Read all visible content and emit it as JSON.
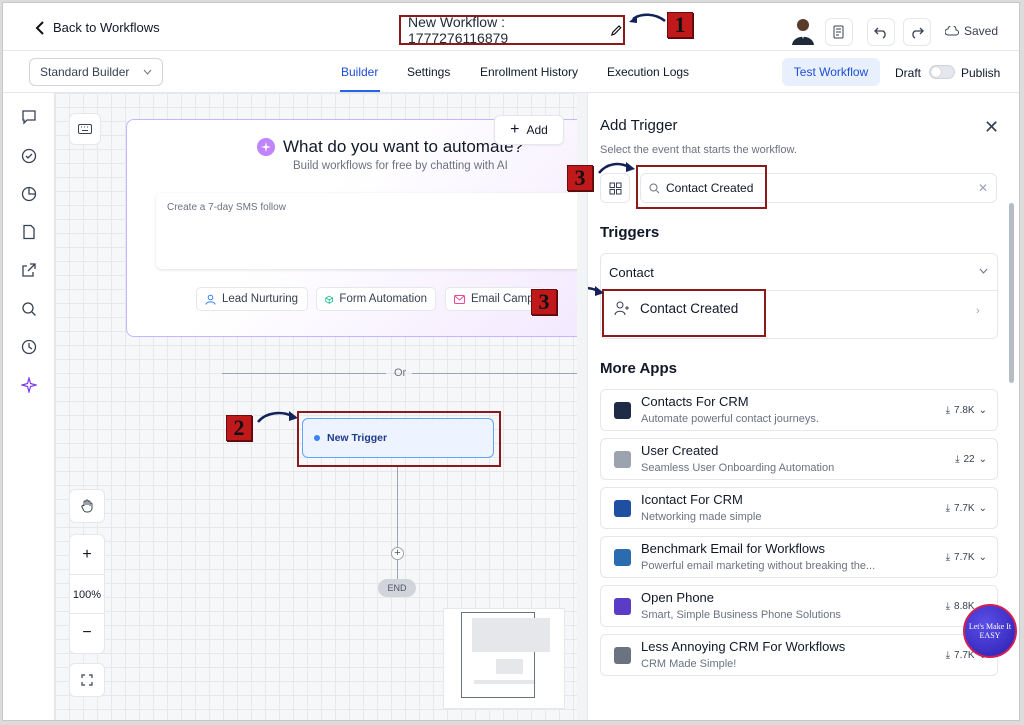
{
  "header": {
    "back_label": "Back to Workflows",
    "workflow_title": "New Workflow : 1777276116879",
    "saved_label": "Saved"
  },
  "subbar": {
    "builder_select": "Standard Builder",
    "tabs": [
      {
        "label": "Builder",
        "active": true
      },
      {
        "label": "Settings"
      },
      {
        "label": "Enrollment History"
      },
      {
        "label": "Execution Logs"
      }
    ],
    "test_button": "Test Workflow",
    "draft_label": "Draft",
    "publish_label": "Publish"
  },
  "annotations": [
    "1",
    "2",
    "3",
    "3"
  ],
  "canvas": {
    "ai_title": "What do you want to automate?",
    "ai_subtitle": "Build workflows for free by chatting with AI",
    "ai_placeholder": "Create a 7-day SMS follow",
    "chips": [
      "Lead Nurturing",
      "Form Automation",
      "Email Camp"
    ],
    "add_label": "Add",
    "or_label": "Or",
    "trigger_label": "New Trigger",
    "end_label": "END",
    "zoom_plus": "+",
    "zoom_level": "100%",
    "zoom_minus": "−"
  },
  "panel": {
    "title": "Add Trigger",
    "subtitle": "Select the event that starts the workflow.",
    "search_value": "Contact Created",
    "triggers_heading": "Triggers",
    "group_label": "Contact",
    "trigger_item": "Contact Created",
    "more_apps_heading": "More Apps",
    "apps": [
      {
        "name": "Contacts For CRM",
        "desc": "Automate powerful contact journeys.",
        "downloads": "7.8K",
        "color": "#1f2a44"
      },
      {
        "name": "User Created",
        "desc": "Seamless User Onboarding Automation",
        "downloads": "22",
        "color": "#9ca3af"
      },
      {
        "name": "Icontact For CRM",
        "desc": "Networking made simple",
        "downloads": "7.7K",
        "color": "#1e4fa0"
      },
      {
        "name": "Benchmark Email for Workflows",
        "desc": "Powerful email marketing without breaking the...",
        "downloads": "7.7K",
        "color": "#2b6cb0"
      },
      {
        "name": "Open Phone",
        "desc": "Smart, Simple Business Phone Solutions",
        "downloads": "8.8K",
        "color": "#5b3cc4"
      },
      {
        "name": "Less Annoying CRM For Workflows",
        "desc": "CRM Made Simple!",
        "downloads": "7.7K",
        "color": "#6b7280"
      }
    ]
  },
  "badge_text": "Let's Make It EASY",
  "colors": {
    "accent": "#2563eb",
    "annotation_red": "#c0191b",
    "highlight_border": "#8b1a1a"
  }
}
